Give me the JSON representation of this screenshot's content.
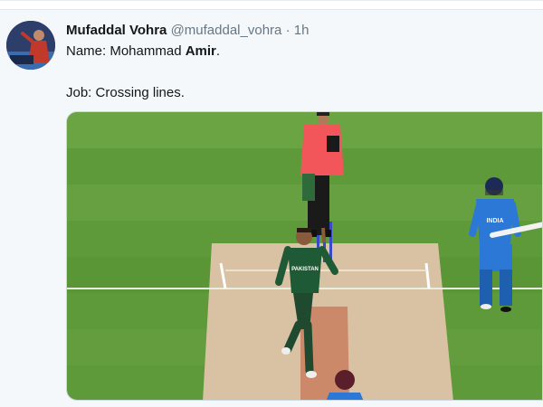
{
  "tweet": {
    "display_name": "Mufaddal Vohra",
    "handle": "@mufaddal_vohra",
    "separator": "·",
    "time": "1h",
    "line1_prefix": "Name: Mohammad ",
    "line1_bold": "Amir",
    "line1_suffix": ".",
    "line2": "Job: Crossing lines."
  },
  "media": {
    "jersey_left_text": "PAKISTAN",
    "jersey_right_text": "INDIA",
    "colors": {
      "grass": "#5f9a3a",
      "pitch": "#d9c2a3",
      "umpire_shirt": "#f2555a",
      "pakistan_kit": "#1f5a36",
      "india_kit": "#2b78d6"
    }
  },
  "avatar": {
    "colors": {
      "bg": "#2d3e6b",
      "accent": "#c0392b"
    }
  }
}
